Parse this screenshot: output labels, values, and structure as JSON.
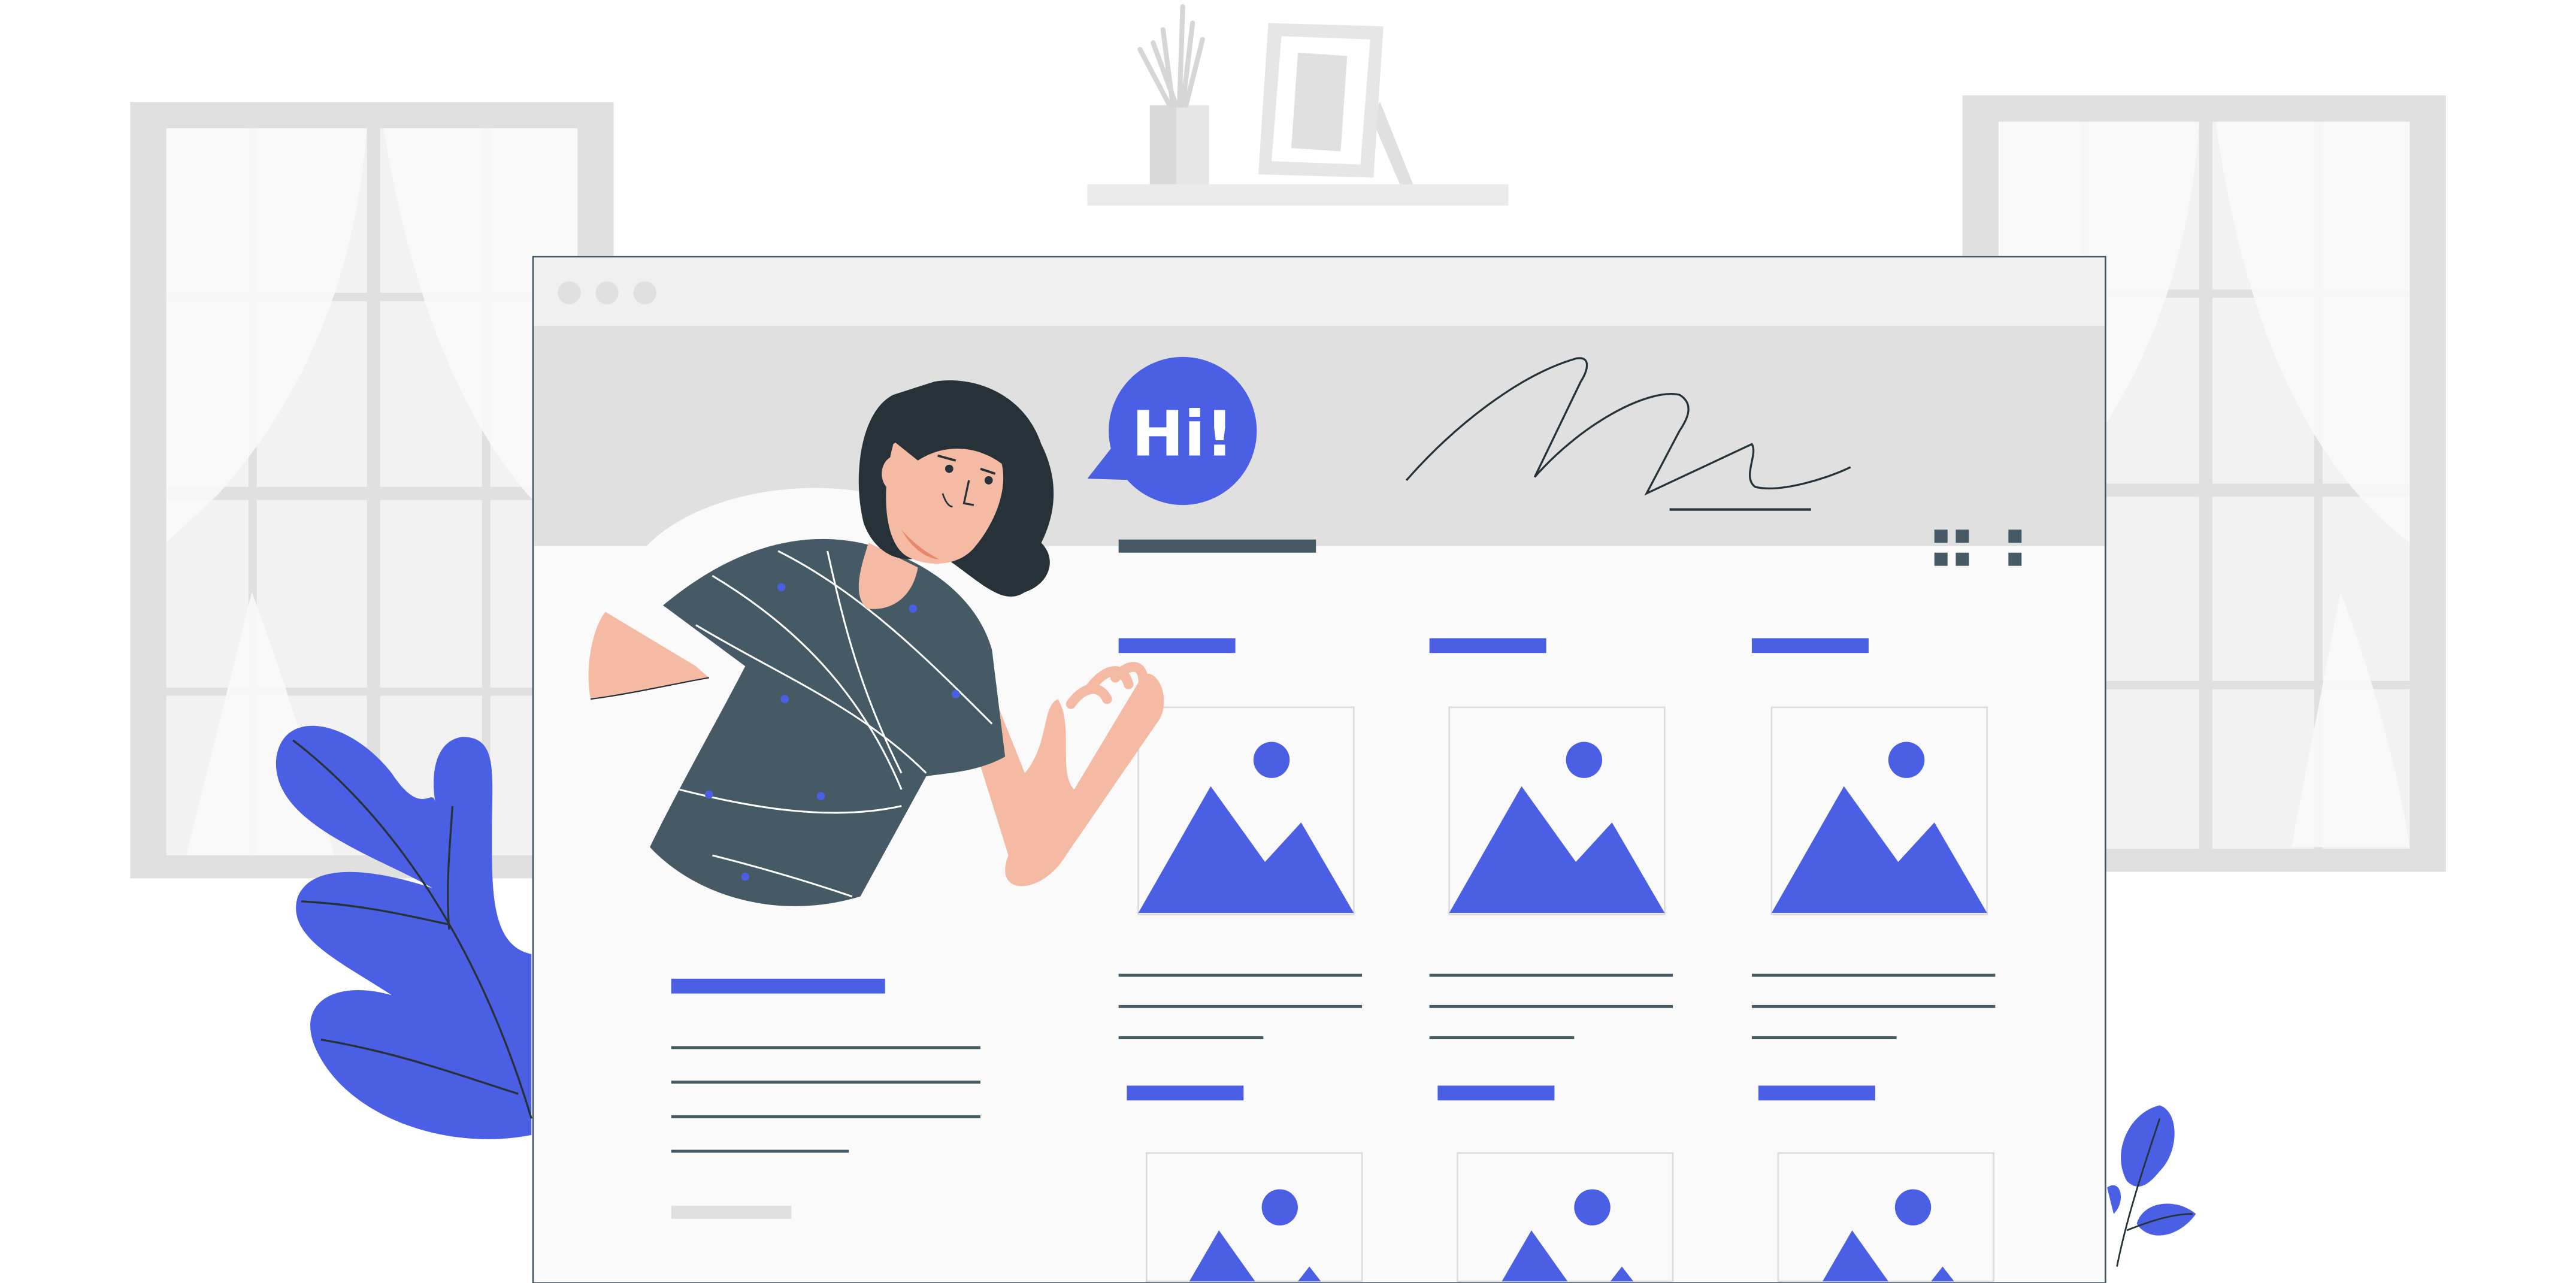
{
  "greeting": {
    "text": "Hi!"
  },
  "palette": {
    "accent": "#4a5fe3",
    "dark": "#455a64",
    "hair": "#263238",
    "skin": "#f5baa3",
    "window_frame": "#e0e0e0",
    "window_bg": "#f0f0f0",
    "browser_bg": "#fafafa",
    "header_band": "#e0e0e0"
  },
  "icons": {
    "browser_controls": [
      "window-dot-icon",
      "window-dot-icon",
      "window-dot-icon"
    ],
    "grid_view": "grid-view-icon",
    "more_options": "more-options-icon",
    "image_placeholder": "image-placeholder-icon"
  }
}
